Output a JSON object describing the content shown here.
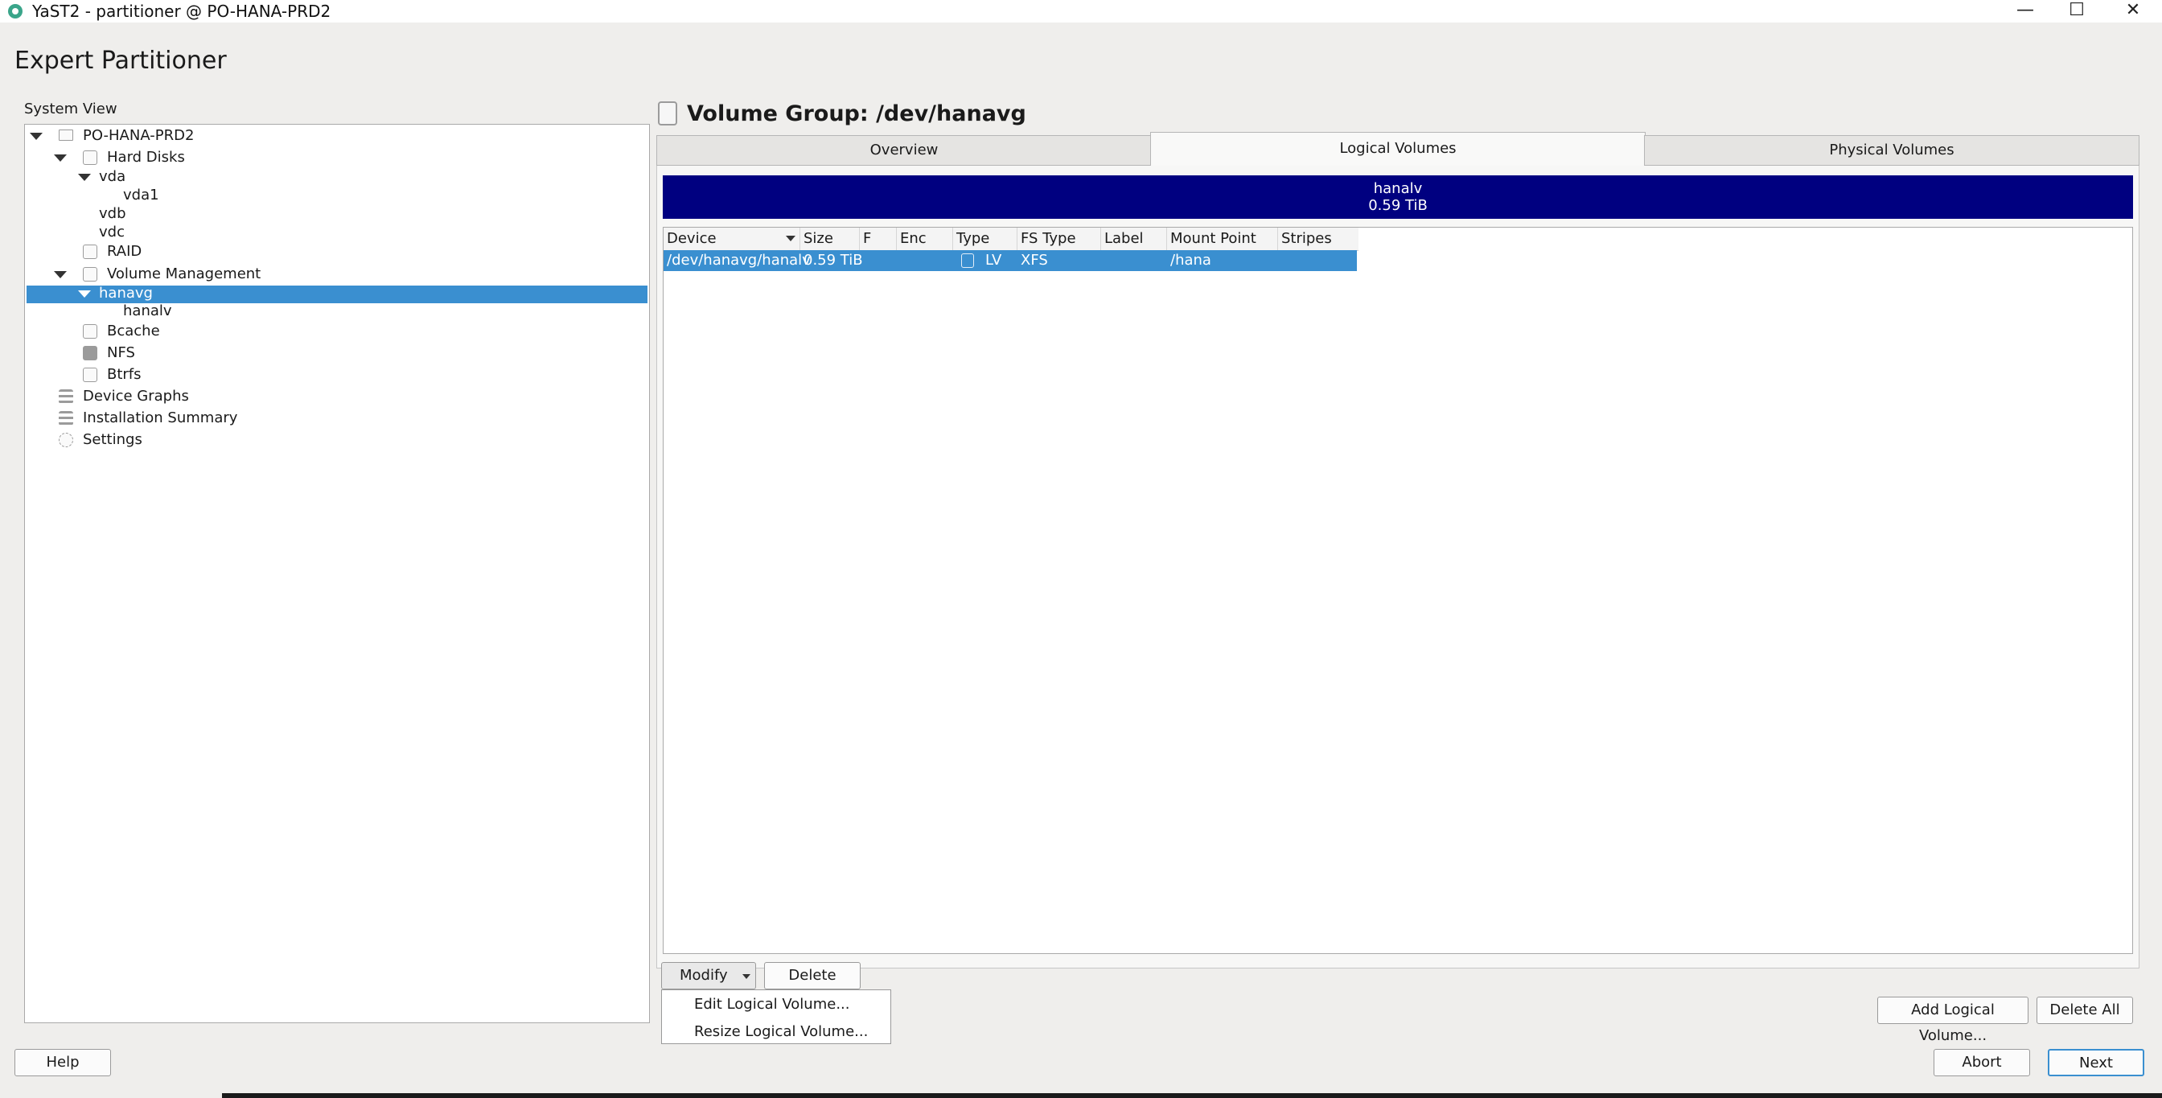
{
  "window": {
    "title": "YaST2 - partitioner @ PO-HANA-PRD2",
    "min": "—",
    "max": "☐",
    "close": "✕"
  },
  "page_title": "Expert Partitioner",
  "system_view": {
    "label": "System View",
    "nodes": {
      "host": "PO-HANA-PRD2",
      "hard_disks": "Hard Disks",
      "vda": "vda",
      "vda1": "vda1",
      "vdb": "vdb",
      "vdc": "vdc",
      "raid": "RAID",
      "volume_management": "Volume Management",
      "hanavg": "hanavg",
      "hanalv": "hanalv",
      "bcache": "Bcache",
      "nfs": "NFS",
      "btrfs": "Btrfs",
      "device_graphs": "Device Graphs",
      "installation_summary": "Installation Summary",
      "settings": "Settings"
    }
  },
  "volume_group": {
    "title": "Volume Group: /dev/hanavg",
    "tabs": {
      "overview": "Overview",
      "logical": "Logical Volumes",
      "physical": "Physical Volumes"
    },
    "usage_bar": {
      "name": "hanalv",
      "size": "0.59 TiB",
      "color": "#000080"
    },
    "table": {
      "headers": {
        "device": "Device",
        "size": "Size",
        "f": "F",
        "enc": "Enc",
        "type": "Type",
        "fs_type": "FS Type",
        "label": "Label",
        "mount": "Mount Point",
        "stripes": "Stripes"
      },
      "row": {
        "device": "/dev/hanavg/hanalv",
        "size": "0.59 TiB",
        "f": "",
        "enc": "",
        "type": "LV",
        "fs_type": "XFS",
        "label": "",
        "mount": "/hana",
        "stripes": ""
      }
    }
  },
  "buttons": {
    "modify": "Modify",
    "delete": "Delete",
    "add_lv": "Add Logical Volume...",
    "delete_all": "Delete All",
    "help": "Help",
    "abort": "Abort",
    "next": "Next"
  },
  "modify_menu": {
    "edit": "Edit Logical Volume...",
    "resize": "Resize Logical Volume..."
  },
  "colors": {
    "selection": "#3a8fd0",
    "background": "#efeeec"
  }
}
